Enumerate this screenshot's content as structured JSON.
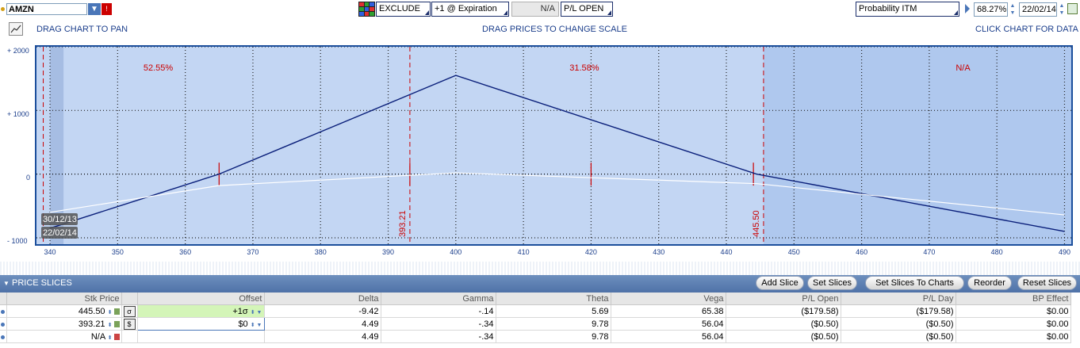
{
  "toolbar": {
    "symbol": "AMZN",
    "exclude_label": "EXCLUDE",
    "expiration_label": "+1 @ Expiration",
    "na_value": "N/A",
    "pl_open_label": "P/L OPEN",
    "probability_label": "Probability ITM",
    "probability_value": "68.27%",
    "date_value": "22/02/14"
  },
  "hints": {
    "drag_pan": "DRAG CHART TO PAN",
    "drag_prices": "DRAG PRICES TO CHANGE SCALE",
    "click_chart": "CLICK CHART FOR DATA"
  },
  "chart": {
    "y_labels": [
      "+ 2000",
      "+ 1000",
      "0",
      "- 1000"
    ],
    "x_labels": [
      "340",
      "350",
      "360",
      "370",
      "380",
      "390",
      "400",
      "410",
      "420",
      "430",
      "440",
      "450",
      "460",
      "470",
      "480",
      "490"
    ],
    "zone_labels": [
      "52.55%",
      "31.58%",
      "N/A"
    ],
    "price_markers": [
      "393.21",
      "445.50"
    ],
    "dates": [
      "30/12/13",
      "22/02/14"
    ],
    "colors": {
      "background": "#c3d6f3",
      "right_zone": "#afc8ee",
      "line_expiration": "#0a1f7a",
      "line_today": "#ffffff",
      "markers": "#cc0000"
    }
  },
  "chart_data": {
    "type": "line",
    "x": [
      340,
      365,
      400,
      444.5,
      490
    ],
    "series": [
      {
        "name": "22/02/14",
        "values": [
          -850,
          0,
          1550,
          0,
          -900
        ]
      },
      {
        "name": "30/12/13",
        "values": [
          -600,
          -180,
          20,
          -150,
          -640
        ]
      }
    ],
    "xlim": [
      338,
      491
    ],
    "ylim": [
      -1100,
      2000
    ]
  },
  "slices": {
    "title": "PRICE SLICES",
    "buttons": [
      "Add Slice",
      "Set Slices",
      "Set Slices To Charts",
      "Reorder",
      "Reset Slices"
    ],
    "columns": [
      "Stk Price",
      "Offset",
      "Delta",
      "Gamma",
      "Theta",
      "Vega",
      "P/L Open",
      "P/L Day",
      "BP Effect"
    ],
    "rows": [
      {
        "price": "445.50",
        "offset": "+1σ",
        "delta": "-9.42",
        "gamma": "-.14",
        "theta": "5.69",
        "vega": "65.38",
        "pl_open": "($179.58)",
        "pl_day": "($179.58)",
        "bp": "$0.00"
      },
      {
        "price": "393.21",
        "offset": "$0",
        "delta": "4.49",
        "gamma": "-.34",
        "theta": "9.78",
        "vega": "56.04",
        "pl_open": "($0.50)",
        "pl_day": "($0.50)",
        "bp": "$0.00"
      },
      {
        "price": "N/A",
        "offset": "",
        "delta": "4.49",
        "gamma": "-.34",
        "theta": "9.78",
        "vega": "56.04",
        "pl_open": "($0.50)",
        "pl_day": "($0.50)",
        "bp": "$0.00"
      }
    ]
  }
}
